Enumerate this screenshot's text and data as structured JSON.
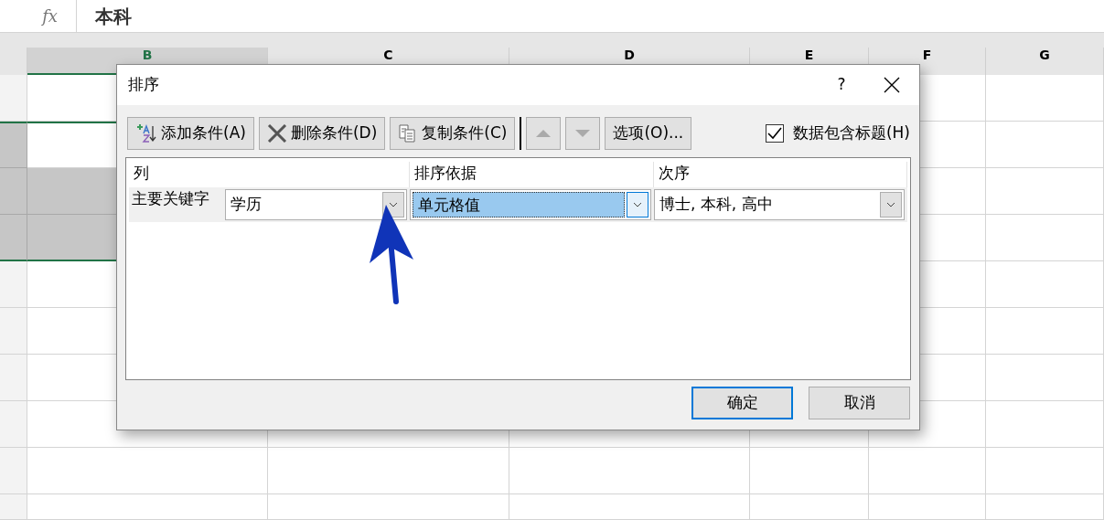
{
  "formula_bar": {
    "function_label": "fx",
    "value": "本科"
  },
  "column_headers": [
    {
      "label": "B",
      "selected": true
    },
    {
      "label": "C",
      "selected": false
    },
    {
      "label": "D",
      "selected": false
    },
    {
      "label": "E",
      "selected": false
    },
    {
      "label": "F",
      "selected": false
    },
    {
      "label": "G",
      "selected": false
    }
  ],
  "grid_rows": [
    {
      "selected": false
    },
    {
      "selected": true
    },
    {
      "selected": true
    },
    {
      "selected": true
    },
    {
      "selected": false
    },
    {
      "selected": false
    },
    {
      "selected": false
    },
    {
      "selected": false
    },
    {
      "selected": false
    },
    {
      "selected": false
    }
  ],
  "dialog": {
    "title": "排序",
    "help": "?",
    "toolbar": [
      {
        "kind": "add",
        "label": "添加条件(A)",
        "disabled": false
      },
      {
        "kind": "delete",
        "label": "删除条件(D)",
        "disabled": false
      },
      {
        "kind": "copy",
        "label": "复制条件(C)",
        "disabled": false
      },
      {
        "kind": "up",
        "disabled": true
      },
      {
        "kind": "down",
        "disabled": true
      },
      {
        "kind": "options",
        "label": "选项(O)...",
        "disabled": false
      }
    ],
    "header_checkbox": {
      "label": "数据包含标题(H)",
      "checked": true
    },
    "columns": [
      "列",
      "排序依据",
      "次序"
    ],
    "rows": [
      {
        "label": "主要关键字",
        "fields": [
          {
            "value": "学历",
            "selected": false
          },
          {
            "value": "单元格值",
            "selected": true
          },
          {
            "value": "博士, 本科, 高中",
            "selected": false
          }
        ]
      }
    ],
    "buttons": [
      {
        "label": "确定",
        "default": true
      },
      {
        "label": "取消",
        "default": false
      }
    ]
  },
  "annotation": {
    "kind": "arrow"
  }
}
